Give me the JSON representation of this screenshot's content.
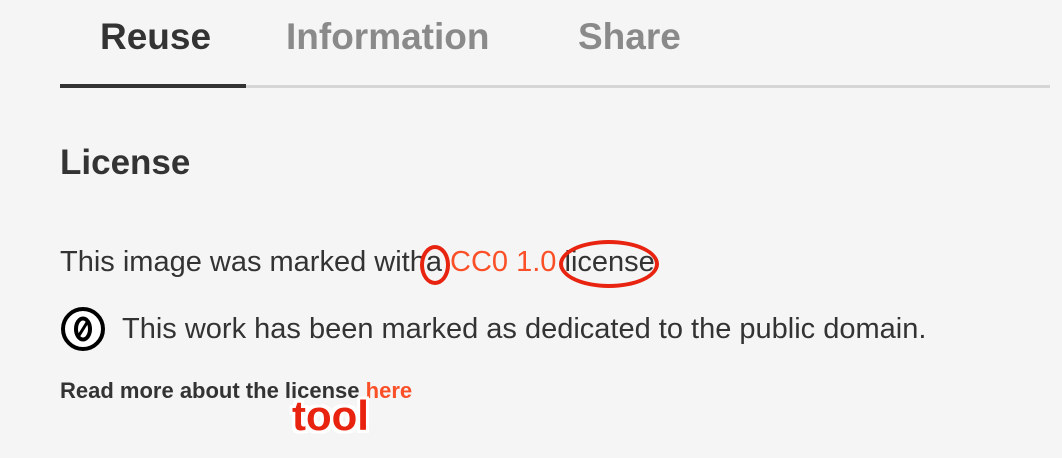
{
  "tabs": [
    {
      "label": "Reuse",
      "active": true
    },
    {
      "label": "Information",
      "active": false
    },
    {
      "label": "Share",
      "active": false
    }
  ],
  "license": {
    "title": "License",
    "intro_prefix": "This image was marked with",
    "article": "a",
    "link_label": "CC0 1.0",
    "suffix_word": "license",
    "public_domain_text": "This work has been marked as dedicated to the public domain.",
    "cc0_icon_glyph": "0",
    "read_more_text": "Read more about the license",
    "read_more_link": "here"
  },
  "annotations": {
    "overlay_label": "tool",
    "circle_color": "#e8230f"
  },
  "colors": {
    "background": "#f5f5f5",
    "text": "#333333",
    "tab_inactive": "#8a8a8a",
    "link": "#fb4f27"
  },
  "icons": {
    "cc0": "cc-zero-icon"
  }
}
